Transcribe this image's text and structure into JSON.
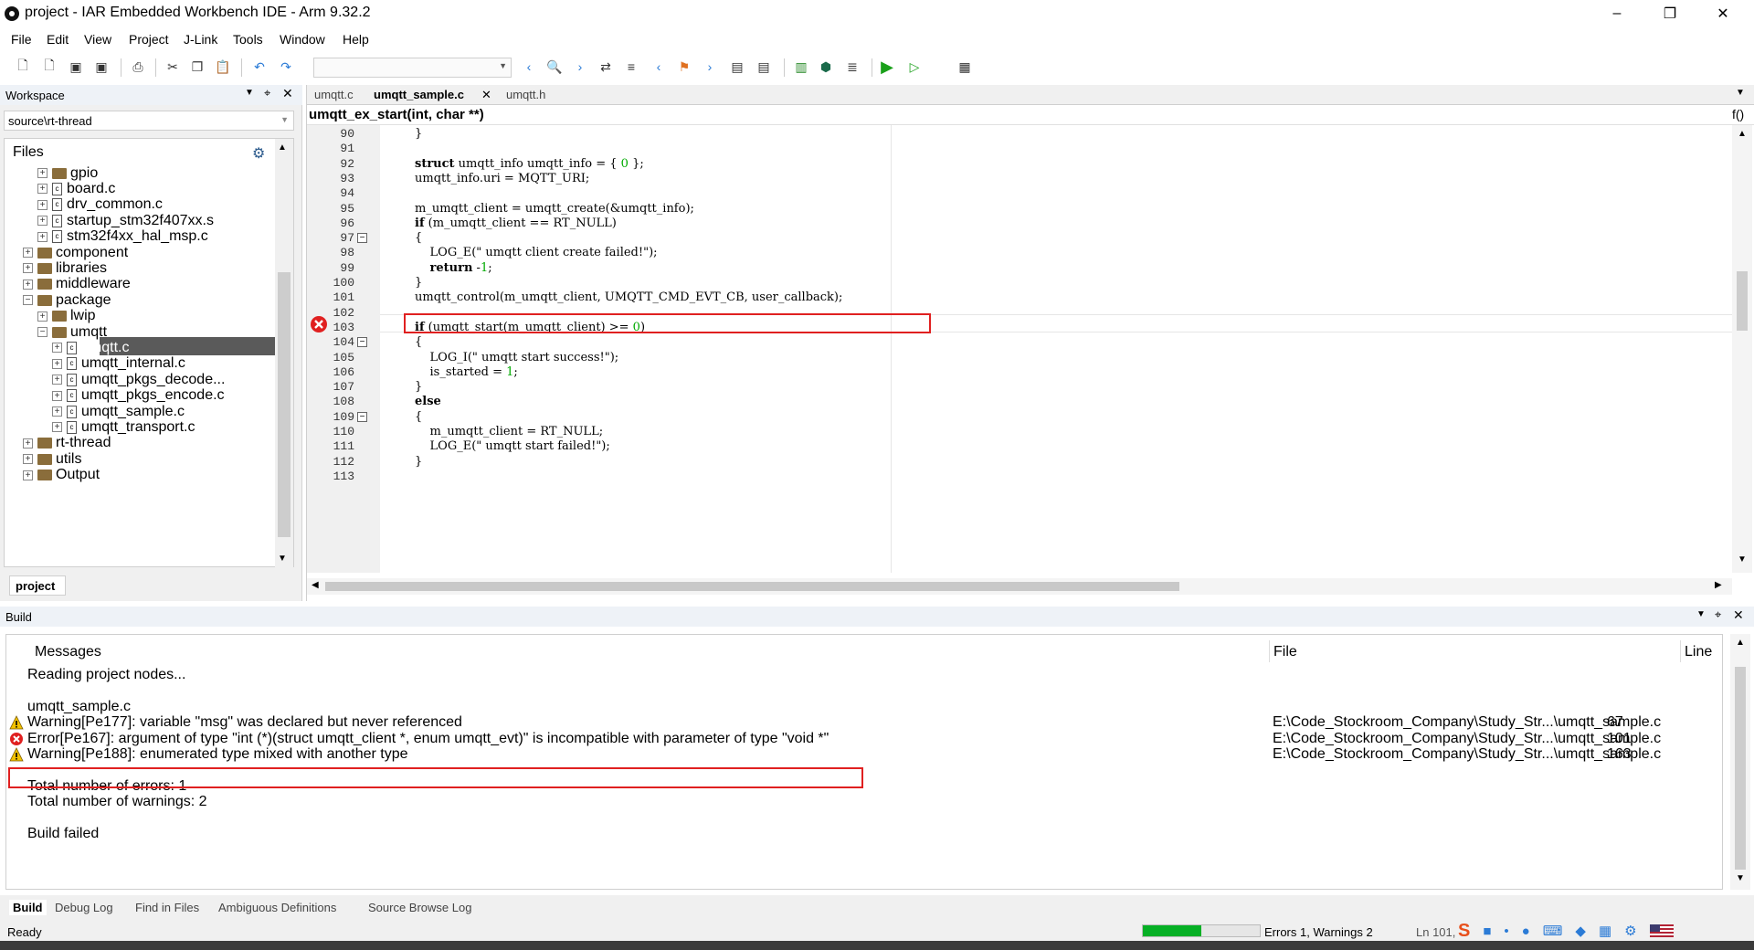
{
  "window": {
    "title": "project - IAR Embedded Workbench IDE - Arm 9.32.2"
  },
  "menu": [
    "File",
    "Edit",
    "View",
    "Project",
    "J-Link",
    "Tools",
    "Window",
    "Help"
  ],
  "workspace": {
    "title": "Workspace",
    "config": "source\\rt-thread",
    "files_header": "Files",
    "tree": [
      {
        "label": "gpio",
        "type": "folder",
        "level": 2
      },
      {
        "label": "board.c",
        "type": "file",
        "level": 2
      },
      {
        "label": "drv_common.c",
        "type": "file",
        "level": 2
      },
      {
        "label": "startup_stm32f407xx.s",
        "type": "file",
        "level": 2
      },
      {
        "label": "stm32f4xx_hal_msp.c",
        "type": "file",
        "level": 2
      },
      {
        "label": "component",
        "type": "folder",
        "level": 1
      },
      {
        "label": "libraries",
        "type": "folder",
        "level": 1
      },
      {
        "label": "middleware",
        "type": "folder",
        "level": 1
      },
      {
        "label": "package",
        "type": "folder",
        "level": 1
      },
      {
        "label": "lwip",
        "type": "folder",
        "level": 2
      },
      {
        "label": "umqtt",
        "type": "folder",
        "level": 2
      },
      {
        "label": "umqtt.c",
        "type": "file",
        "level": 3,
        "selected": true
      },
      {
        "label": "umqtt_internal.c",
        "type": "file",
        "level": 3
      },
      {
        "label": "umqtt_pkgs_decode...",
        "type": "file",
        "level": 3
      },
      {
        "label": "umqtt_pkgs_encode.c",
        "type": "file",
        "level": 3
      },
      {
        "label": "umqtt_sample.c",
        "type": "file",
        "level": 3
      },
      {
        "label": "umqtt_transport.c",
        "type": "file",
        "level": 3
      },
      {
        "label": "rt-thread",
        "type": "folder",
        "level": 1
      },
      {
        "label": "utils",
        "type": "folder",
        "level": 1
      },
      {
        "label": "Output",
        "type": "folder",
        "level": 1
      }
    ],
    "tab": "project"
  },
  "editor": {
    "tabs": [
      {
        "label": "umqtt.c",
        "active": false
      },
      {
        "label": "umqtt_sample.c",
        "active": true
      },
      {
        "label": "umqtt.h",
        "active": false
      }
    ],
    "function": "umqtt_ex_start(int, char **)",
    "func_icon": "f()",
    "lines": [
      {
        "n": "90",
        "t": "}"
      },
      {
        "n": "91",
        "t": ""
      },
      {
        "n": "92",
        "t": "struct umqtt_info umqtt_info = { 0 };"
      },
      {
        "n": "93",
        "t": "umqtt_info.uri = MQTT_URI;"
      },
      {
        "n": "94",
        "t": ""
      },
      {
        "n": "95",
        "t": "m_umqtt_client = umqtt_create(&umqtt_info);"
      },
      {
        "n": "96",
        "t": "if (m_umqtt_client == RT_NULL)"
      },
      {
        "n": "97",
        "t": "{"
      },
      {
        "n": "98",
        "t": "    LOG_E(\" umqtt client create failed!\");"
      },
      {
        "n": "99",
        "t": "    return -1;"
      },
      {
        "n": "100",
        "t": "}"
      },
      {
        "n": "101",
        "t": "umqtt_control(m_umqtt_client, UMQTT_CMD_EVT_CB, user_callback);"
      },
      {
        "n": "102",
        "t": ""
      },
      {
        "n": "103",
        "t": "if (umqtt_start(m_umqtt_client) >= 0)"
      },
      {
        "n": "104",
        "t": "{"
      },
      {
        "n": "105",
        "t": "    LOG_I(\" umqtt start success!\");"
      },
      {
        "n": "106",
        "t": "    is_started = 1;"
      },
      {
        "n": "107",
        "t": "}"
      },
      {
        "n": "108",
        "t": "else"
      },
      {
        "n": "109",
        "t": "{"
      },
      {
        "n": "110",
        "t": "    m_umqtt_client = RT_NULL;"
      },
      {
        "n": "111",
        "t": "    LOG_E(\" umqtt start failed!\");"
      },
      {
        "n": "112",
        "t": "}"
      },
      {
        "n": "113",
        "t": ""
      }
    ]
  },
  "build": {
    "title": "Build",
    "headers": {
      "messages": "Messages",
      "file": "File",
      "line": "Line"
    },
    "rows": [
      {
        "icon": "",
        "msg": "Reading project nodes...",
        "file": "",
        "line": ""
      },
      {
        "icon": "",
        "msg": "",
        "file": "",
        "line": ""
      },
      {
        "icon": "",
        "msg": "umqtt_sample.c",
        "file": "",
        "line": ""
      },
      {
        "icon": "warning",
        "msg": "Warning[Pe177]: variable \"msg\" was declared but never referenced",
        "file": "E:\\Code_Stockroom_Company\\Study_Str...\\umqtt_sample.c",
        "line": "67"
      },
      {
        "icon": "error",
        "msg": "Error[Pe167]: argument of type \"int (*)(struct umqtt_client *, enum umqtt_evt)\" is incompatible with parameter of type \"void *\"",
        "file": "E:\\Code_Stockroom_Company\\Study_Str...\\umqtt_sample.c",
        "line": "101"
      },
      {
        "icon": "warning",
        "msg": "Warning[Pe188]: enumerated type mixed with another type",
        "file": "E:\\Code_Stockroom_Company\\Study_Str...\\umqtt_sample.c",
        "line": "163"
      },
      {
        "icon": "",
        "msg": "",
        "file": "",
        "line": ""
      },
      {
        "icon": "",
        "msg": "Total number of errors: 1",
        "file": "",
        "line": ""
      },
      {
        "icon": "",
        "msg": "Total number of warnings: 2",
        "file": "",
        "line": ""
      },
      {
        "icon": "",
        "msg": "",
        "file": "",
        "line": ""
      },
      {
        "icon": "",
        "msg": "Build failed",
        "file": "",
        "line": ""
      }
    ],
    "tabs": [
      "Build",
      "Debug Log",
      "Find in Files",
      "Ambiguous Definitions",
      "Source Browse Log"
    ]
  },
  "status": {
    "text": "Ready",
    "progress": 0.5,
    "errors": "Errors 1, Warnings 2",
    "position": "Ln 101,"
  },
  "colors": {
    "error": "#e02020",
    "warning": "#f2c200",
    "progress": "#06b025",
    "accent": "#2b7bd6"
  }
}
